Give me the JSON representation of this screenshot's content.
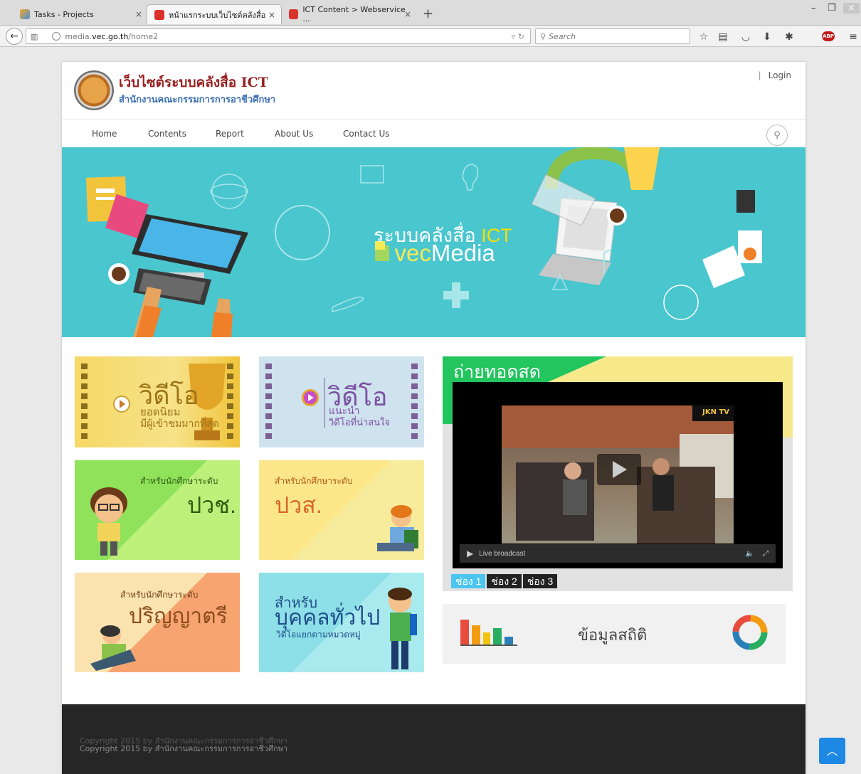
{
  "browser": {
    "tabs": [
      {
        "title": "Tasks - Projects"
      },
      {
        "title": "หน้าแรกระบบเว็บไซต์คลังสื่อ"
      },
      {
        "title": "ICT Content > Webservice ..."
      }
    ],
    "close_glyph": "×",
    "new_tab": "+",
    "url_prefix": "media.",
    "url_domain": "vec.go.th",
    "url_path": "/home2",
    "search_placeholder": "Search"
  },
  "site": {
    "title": "เว็บไซต์ระบบคลังสื่อ ICT",
    "subtitle": "สำนักงานคณะกรรมการการอาชีวศึกษา",
    "login": "Login",
    "menu": [
      "Home",
      "Contents",
      "Report",
      "About Us",
      "Contact Us"
    ]
  },
  "banner": {
    "title_thai": "ระบบคลังสื่อ ",
    "title_hl": "ICT",
    "sub_vec": "vec",
    "sub_media": "Media"
  },
  "tiles": {
    "popular": {
      "big": "วิดีโอ",
      "line1": "ยอดนิยม",
      "line2": "มีผู้เข้าชมมากที่สุด"
    },
    "recommended": {
      "big": "วิดีโอ",
      "line1": "แนะนำ",
      "line2": "วิดีโอที่น่าสนใจ"
    },
    "pvc": {
      "line1": "สำหรับนักศึกษาระดับ",
      "big": "ปวช."
    },
    "pvs": {
      "line1": "สำหรับนักศึกษาระดับ",
      "big": "ปวส."
    },
    "bachelor": {
      "line1": "สำหรับนักศึกษาระดับ",
      "big": "ปริญญาตรี"
    },
    "general": {
      "line1": "สำหรับ",
      "big": "บุคคลทั่วไป",
      "line2": "วิดีโอแยกตามหมวดหมู่"
    }
  },
  "live": {
    "title": "ถ่ายทอดสด",
    "controls_label": "Live broadcast",
    "channels": [
      "ช่อง 1",
      "ช่อง 2",
      "ช่อง 3"
    ],
    "active_channel": 0,
    "logo": "JKN TV"
  },
  "stats": {
    "label": "ข้อมูลสถิติ"
  },
  "footer": {
    "copyright": "Copyright 2015 by สำนักงานคณะกรรมการการอาชีวศึกษา"
  },
  "colors": {
    "banner": "#4ac6cf",
    "title_red": "#9a1f1f",
    "subtitle_blue": "#3d6fb5",
    "live_green": "#22c55e",
    "live_yellow": "#f7e98a",
    "channel_active": "#4ac6ef",
    "to_top": "#1e88e5"
  },
  "icons": {
    "back": "back-arrow-icon",
    "reader": "reader-view-icon",
    "globe": "site-identity-icon",
    "reload": "reload-icon",
    "search": "search-icon",
    "bookmark": "bookmark-star-icon",
    "library": "library-icon",
    "pocket": "pocket-icon",
    "download": "download-icon",
    "extension": "extension-icon",
    "abp": "adblock-plus-icon",
    "menu": "hamburger-menu-icon",
    "to_top": "chevron-up-icon"
  }
}
